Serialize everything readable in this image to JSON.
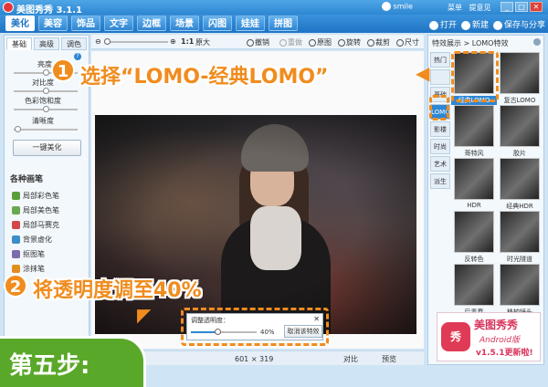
{
  "window": {
    "title": "美图秀秀 3.1.1",
    "user": "smile",
    "links": [
      "菜单",
      "提意见"
    ],
    "controls": [
      "_",
      "□",
      "✕"
    ]
  },
  "menu": {
    "tabs": [
      "美化",
      "美容",
      "饰品",
      "文字",
      "边框",
      "场景",
      "闪图",
      "娃娃",
      "拼图"
    ],
    "active_index": 0,
    "open": "打开",
    "new": "新建",
    "save_share": "保存与分享"
  },
  "left_panel": {
    "tabs": [
      "基础",
      "高级",
      "调色"
    ],
    "help": "?",
    "sliders": [
      {
        "label": "亮度",
        "value": 0.5
      },
      {
        "label": "对比度",
        "value": 0.5
      },
      {
        "label": "色彩饱和度",
        "value": 0.5
      },
      {
        "label": "清晰度",
        "value": 0.05
      }
    ],
    "one_key_button": "一键美化",
    "brush_title": "各种画笔",
    "brushes": [
      {
        "label": "局部彩色笔",
        "color": "#5a9e3a"
      },
      {
        "label": "局部美色笔",
        "color": "#6aa84f"
      },
      {
        "label": "局部马赛克",
        "color": "#d04848"
      },
      {
        "label": "背景虚化",
        "color": "#3c8dc9"
      },
      {
        "label": "抠图笔",
        "color": "#7c6bb0"
      },
      {
        "label": "涂抹笔",
        "color": "#e09020"
      }
    ]
  },
  "toolbar": {
    "zoom_ratio": "1:1",
    "original_size": "原大",
    "undo": "撤销",
    "redo": "重做",
    "original": "原图",
    "rotate": "旋转",
    "crop": "裁剪",
    "size": "尺寸"
  },
  "status": {
    "dimensions": "601 × 319",
    "compare": "对比",
    "preview": "预览"
  },
  "opacity_dialog": {
    "title": "调整透明度：",
    "close": "✕",
    "value_label": "40%",
    "value": 0.4,
    "cancel": "取消该特效"
  },
  "right_panel": {
    "title": "特效展示 > LOMO特效",
    "categories": [
      "热门",
      "",
      "基础",
      "LOMO",
      "影楼",
      "时尚",
      "艺术",
      "派生"
    ],
    "active_category": 3,
    "effects": [
      {
        "label": "经典LOMO",
        "selected": true
      },
      {
        "label": "复古LOMO",
        "selected": false
      },
      {
        "label": "哥特风",
        "selected": false
      },
      {
        "label": "胶片",
        "selected": false
      },
      {
        "label": "HDR",
        "selected": false
      },
      {
        "label": "经典HDR",
        "selected": false
      },
      {
        "label": "反转色",
        "selected": false
      },
      {
        "label": "时光隧道",
        "selected": false
      },
      {
        "label": "后青春",
        "selected": false
      },
      {
        "label": "移轴镜头",
        "selected": false
      }
    ]
  },
  "annotations": {
    "step1_number": "1",
    "step1_text": "选择“LOMO-经典LOMO”",
    "step2_number": "2",
    "step2_text": "将透明度调至40%",
    "badge_text": "第五步:"
  },
  "ad": {
    "logo": "秀",
    "title": "美图秀秀",
    "subtitle": "Android版",
    "version": "v1.5.1更新啦!"
  },
  "colors": {
    "accent": "#f08c1e",
    "title_bar": "#2d86d1",
    "badge": "#5aa829"
  }
}
